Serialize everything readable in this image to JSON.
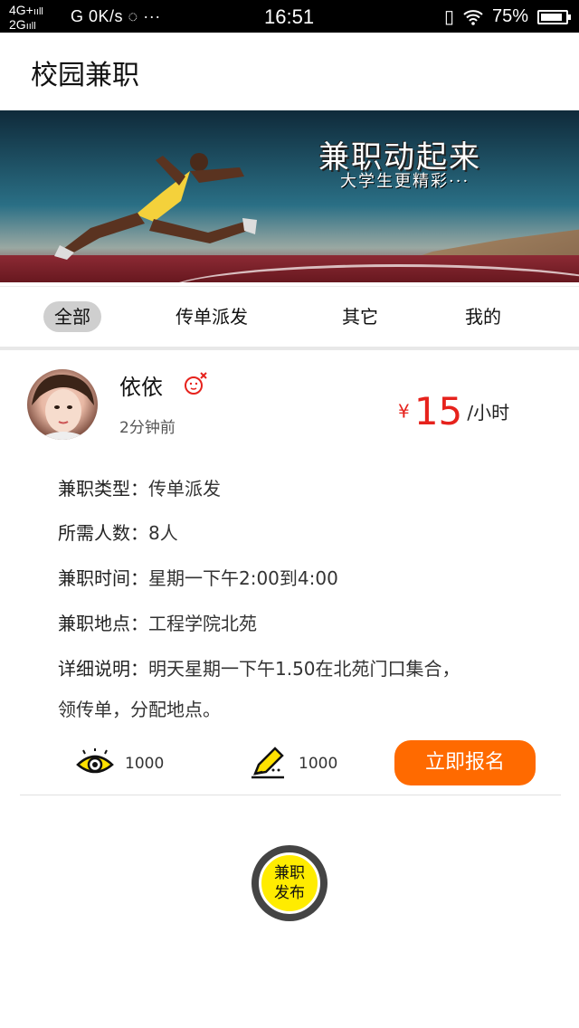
{
  "status_bar": {
    "network_top": "4G+",
    "network_bottom": "2G",
    "net_speed": "G 0K/s",
    "extra": "◌ ···",
    "time": "16:51",
    "battery": "75%"
  },
  "app": {
    "title": "校园兼职"
  },
  "banner": {
    "headline": "兼职动起来",
    "subline": "大学生更精彩···"
  },
  "tabs": [
    {
      "label": "全部",
      "active": true
    },
    {
      "label": "传单派发"
    },
    {
      "label": "其它"
    },
    {
      "label": "我的"
    }
  ],
  "post": {
    "username": "依依",
    "time_ago": "2分钟前",
    "price_symbol": "¥",
    "price": "15",
    "price_unit": "/小时",
    "fields": [
      {
        "label": "兼职类型：",
        "value": "传单派发"
      },
      {
        "label": "所需人数：",
        "value": "8人"
      },
      {
        "label": "兼职时间：",
        "value": "星期一下午2:00到4:00"
      },
      {
        "label": "兼职地点：",
        "value": "工程学院北苑"
      },
      {
        "label": "详细说明：",
        "value": "明天星期一下午1.50在北苑门口集合，"
      }
    ],
    "detail_cont": "领传单，分配地点。",
    "views": "1000",
    "signups": "1000",
    "apply_label": "立即报名"
  },
  "fab": {
    "line1": "兼职",
    "line2": "发布"
  },
  "colors": {
    "accent": "#ff6a00",
    "price": "#e6221c",
    "fab": "#ffec00"
  }
}
